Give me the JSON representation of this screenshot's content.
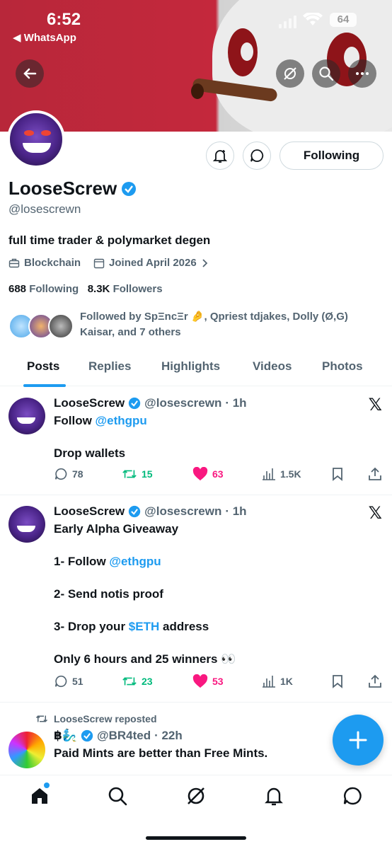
{
  "status_bar": {
    "time": "6:52",
    "back_app": "WhatsApp",
    "battery": "64"
  },
  "header": {
    "back_icon": "arrow-left-icon",
    "grok_icon": "grok-icon",
    "search_icon": "search-icon",
    "more_icon": "more-icon"
  },
  "profile": {
    "name": "LooseScrew",
    "handle": "@losescrewn",
    "bio": "full time trader & polymarket degen",
    "category": "Blockchain",
    "joined": "Joined April 2026",
    "following_count": "688",
    "following_label": "Following",
    "followers_count": "8.3K",
    "followers_label": "Followers",
    "followed_by": "Followed by SpΞncΞr 🤌, Qpriest tdjakes, Dolly (Ø,G) Kaisar, and 7 others",
    "follow_button": "Following"
  },
  "tabs": [
    "Posts",
    "Replies",
    "Highlights",
    "Videos",
    "Photos"
  ],
  "posts": [
    {
      "name": "LooseScrew",
      "handle": "@losescrewn",
      "time": "· 1h",
      "lines": [
        "Follow ",
        "@ethgpu",
        "",
        "Drop wallets"
      ],
      "replies": "78",
      "reposts": "15",
      "likes": "63",
      "views": "1.5K"
    },
    {
      "name": "LooseScrew",
      "handle": "@losescrewn",
      "time": "· 1h",
      "title": "Early Alpha Giveaway",
      "step1_prefix": "1- Follow ",
      "step1_link": "@ethgpu",
      "step2": "2- Send notis proof",
      "step3_prefix": "3- Drop your ",
      "step3_link": "$ETH",
      "step3_suffix": " address",
      "closing": "Only 6 hours and 25 winners 👀",
      "replies": "51",
      "reposts": "23",
      "likes": "53",
      "views": "1K"
    },
    {
      "repost_label": "LooseScrew reposted",
      "name": "฿🧞‍♂️",
      "handle": "@BR4ted",
      "time": "· 22h",
      "text": "Paid Mints are better than Free Mints."
    }
  ],
  "colors": {
    "accent": "#1d9bf0",
    "repost": "#00ba7c",
    "like": "#f91880",
    "secondary_text": "#536471"
  }
}
